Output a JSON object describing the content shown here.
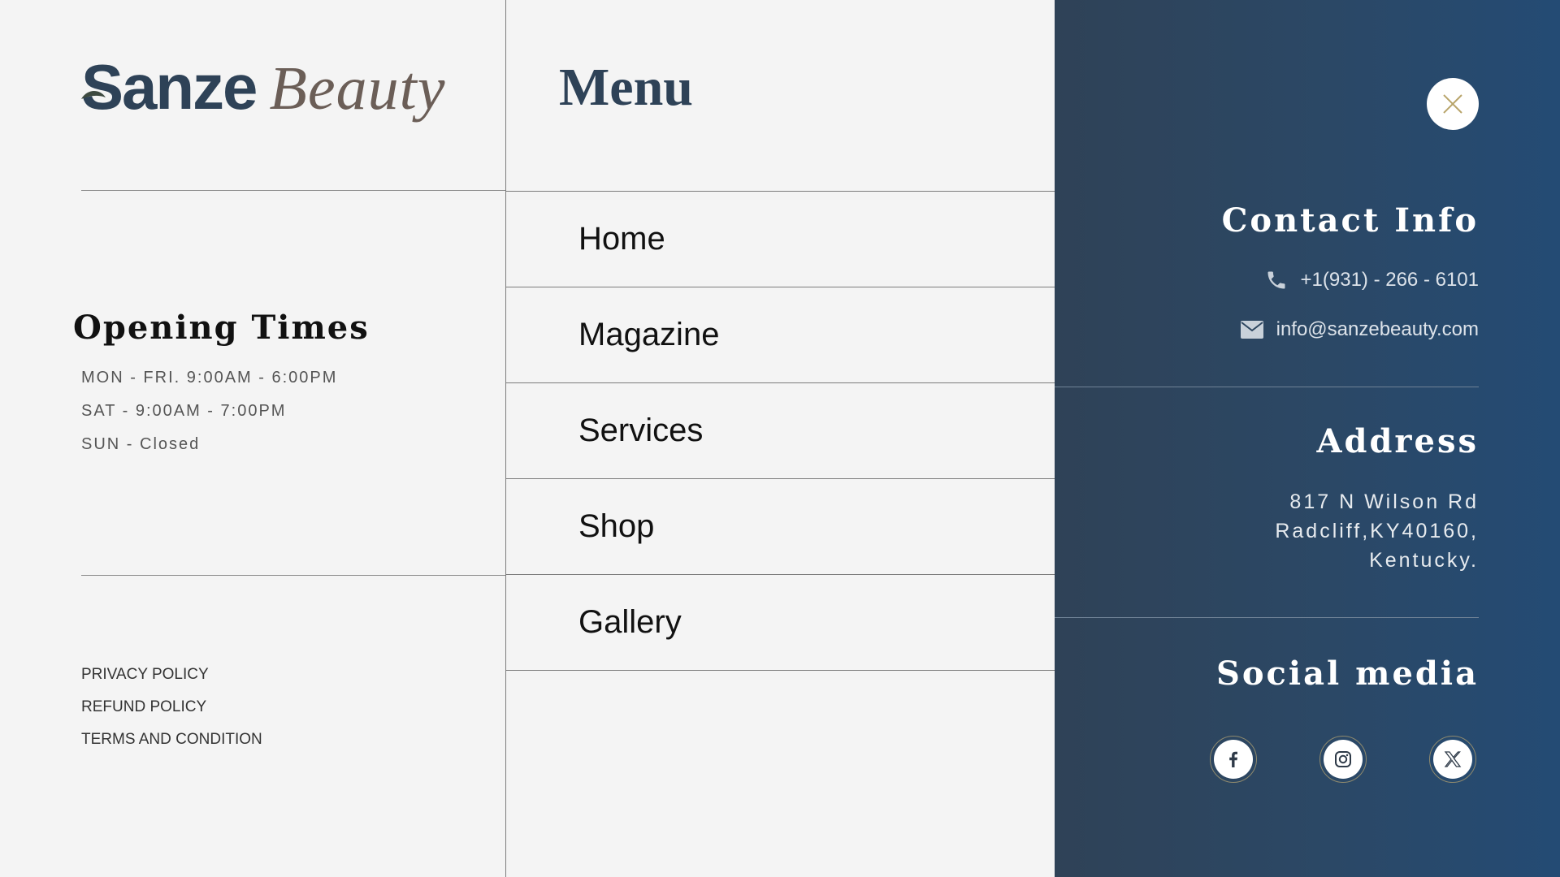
{
  "brand": {
    "name_part1": "Sanze",
    "name_part2": "Beauty"
  },
  "opening": {
    "title": "Opening Times",
    "hours": [
      "MON - FRI. 9:00AM - 6:00PM",
      "SAT - 9:00AM - 7:00PM",
      "SUN - Closed"
    ]
  },
  "policies": [
    "PRIVACY POLICY",
    "REFUND POLICY",
    "TERMS AND CONDITION"
  ],
  "menu": {
    "title": "Menu",
    "items": [
      "Home",
      "Magazine",
      "Services",
      "Shop",
      "Gallery"
    ]
  },
  "contact": {
    "title": "Contact Info",
    "phone": "+1(931) - 266 - 6101",
    "email": "info@sanzebeauty.com",
    "phone_icon": "phone-icon",
    "email_icon": "envelope-icon"
  },
  "address": {
    "title": "Address",
    "lines": [
      "817 N Wilson Rd",
      "Radcliff,KY40160,",
      "Kentucky."
    ]
  },
  "social": {
    "title": "Social media",
    "networks": [
      "facebook-icon",
      "instagram-icon",
      "x-icon"
    ]
  },
  "colors": {
    "brand_dark": "#2e4257",
    "brand_brown": "#6b5e57",
    "panel_gradient_start": "#2f4257",
    "panel_gradient_end": "#244b74",
    "close_x": "#b8a46a"
  }
}
